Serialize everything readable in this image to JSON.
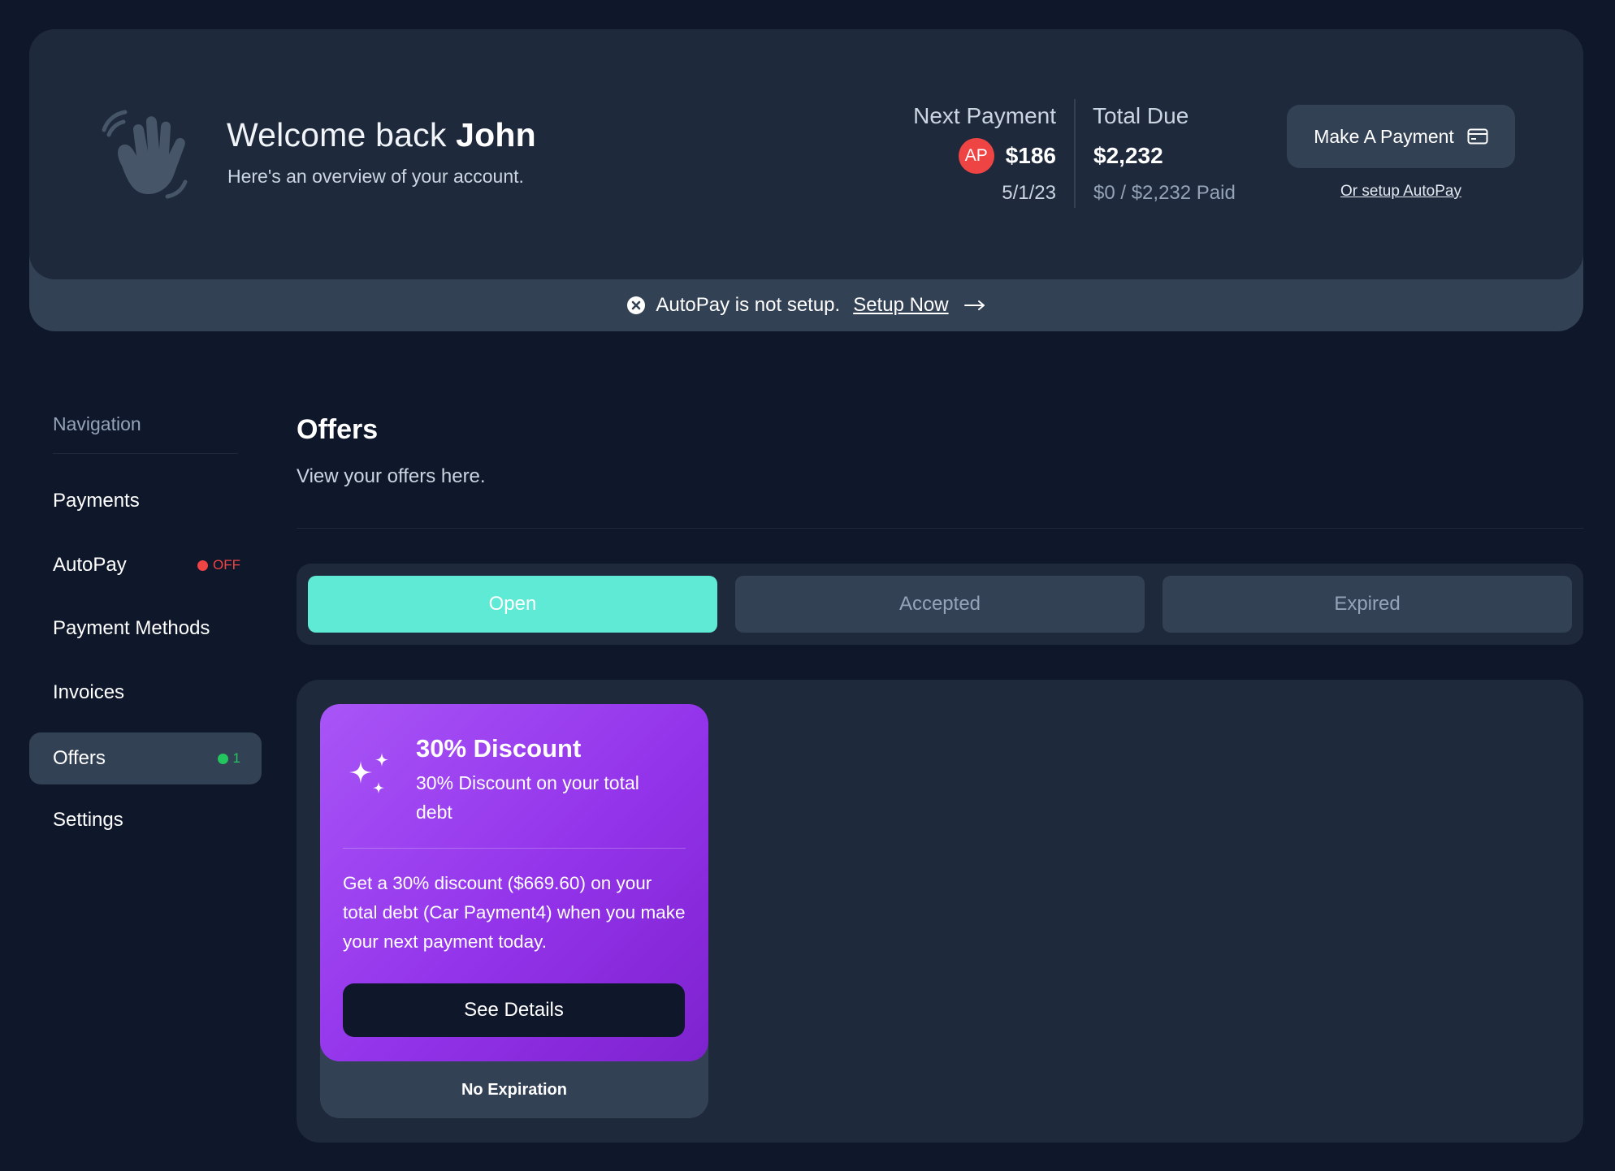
{
  "header": {
    "greeting": "Welcome back",
    "user_name": "John",
    "subtitle": "Here's an overview of your account.",
    "next_payment": {
      "label": "Next Payment",
      "badge": "AP",
      "amount": "$186",
      "date": "5/1/23"
    },
    "total_due": {
      "label": "Total Due",
      "amount": "$2,232",
      "paid": "$0 / $2,232 Paid"
    },
    "pay_button_label": "Make A Payment",
    "autopay_link": "Or setup AutoPay"
  },
  "banner": {
    "message": "AutoPay is not setup.",
    "link": "Setup Now"
  },
  "sidebar": {
    "heading": "Navigation",
    "items": [
      {
        "label": "Payments"
      },
      {
        "label": "AutoPay",
        "status": "OFF"
      },
      {
        "label": "Payment Methods"
      },
      {
        "label": "Invoices"
      },
      {
        "label": "Offers",
        "count": "1"
      },
      {
        "label": "Settings"
      }
    ]
  },
  "main": {
    "title": "Offers",
    "subtitle": "View your offers here.",
    "tabs": [
      {
        "label": "Open"
      },
      {
        "label": "Accepted"
      },
      {
        "label": "Expired"
      }
    ],
    "offer": {
      "title": "30% Discount",
      "subtitle": "30% Discount on your total debt",
      "description": "Get a 30% discount ($669.60) on your total debt (Car Payment4) when you make your next payment today.",
      "button_label": "See Details",
      "expiration": "No Expiration"
    }
  },
  "colors": {
    "background": "#0f172a",
    "card": "#1e293b",
    "accent_teal": "#5eead4",
    "offer_purple": "#9333ea",
    "status_red": "#ef4444",
    "status_green": "#22c55e"
  }
}
